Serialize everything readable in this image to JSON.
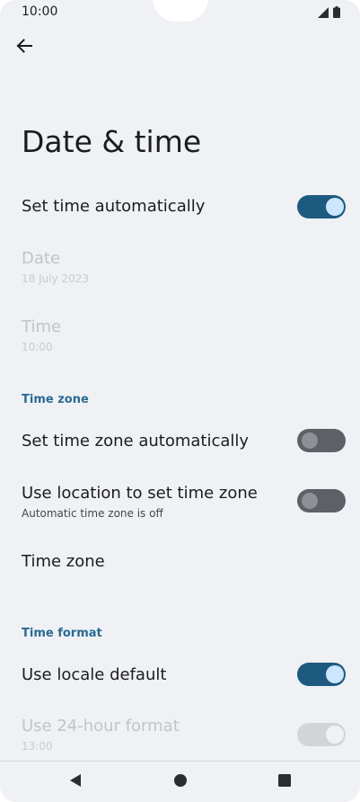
{
  "status_bar": {
    "time": "10:00"
  },
  "header": {
    "title": "Date & time"
  },
  "settings": {
    "set_time_automatically": {
      "title": "Set time automatically",
      "on": true
    },
    "date": {
      "title": "Date",
      "value": "18 July 2023"
    },
    "time": {
      "title": "Time",
      "value": "10:00"
    },
    "time_zone_section": "Time zone",
    "set_time_zone_automatically": {
      "title": "Set time zone automatically",
      "on": false
    },
    "use_location": {
      "title": "Use location to set time zone",
      "summary": "Automatic time zone is off",
      "on": false
    },
    "time_zone": {
      "title": "Time zone"
    },
    "time_format_section": "Time format",
    "use_locale_default": {
      "title": "Use locale default",
      "on": true
    },
    "use_24_hour": {
      "title": "Use 24-hour format",
      "value": "13:00",
      "on": true
    }
  },
  "icons": {
    "back": "arrow-left-icon",
    "signal": "signal-icon",
    "battery": "battery-icon",
    "nav_back": "triangle-back-icon",
    "nav_home": "circle-home-icon",
    "nav_recents": "square-recents-icon"
  },
  "colors": {
    "background": "#eff1f4",
    "accent": "#1e5a80",
    "section_header": "#2a6a93",
    "text_primary": "#1b1c1f",
    "text_disabled": "#c1c4c8"
  }
}
